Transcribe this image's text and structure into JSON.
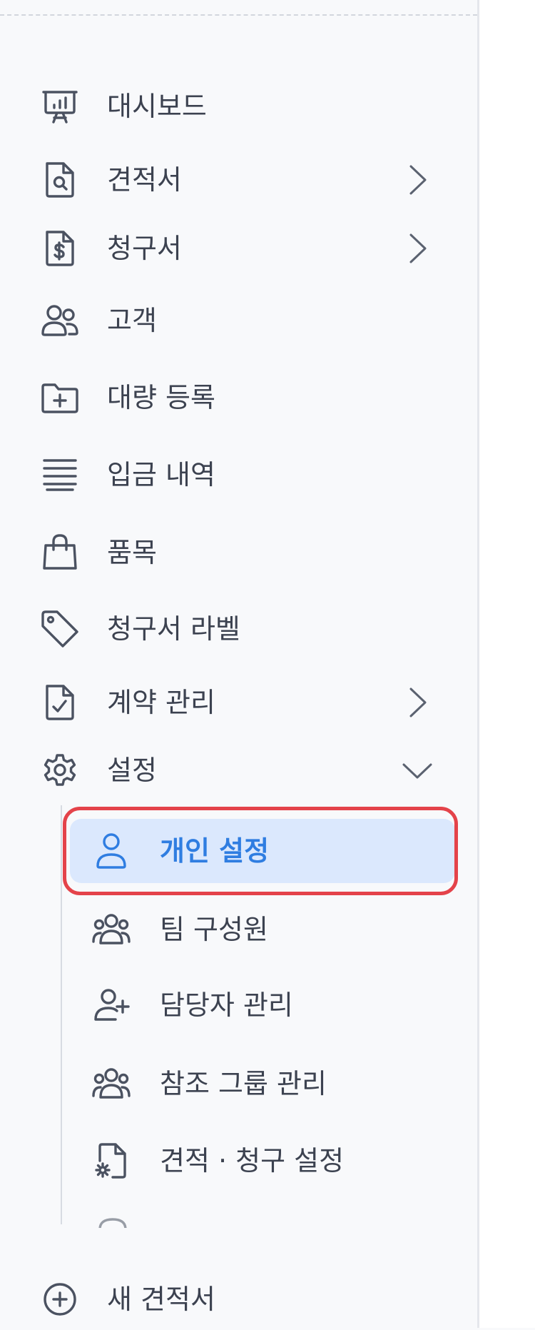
{
  "nav": {
    "items": [
      {
        "label": "대시보드",
        "icon": "presentation-chart-icon"
      },
      {
        "label": "견적서",
        "icon": "file-search-icon",
        "has_submenu": true
      },
      {
        "label": "청구서",
        "icon": "file-dollar-icon",
        "has_submenu": true
      },
      {
        "label": "고객",
        "icon": "users-icon"
      },
      {
        "label": "대량 등록",
        "icon": "folder-plus-icon"
      },
      {
        "label": "입금 내역",
        "icon": "list-lines-icon"
      },
      {
        "label": "품목",
        "icon": "shopping-bag-icon"
      },
      {
        "label": "청구서 라벨",
        "icon": "tag-icon"
      },
      {
        "label": "계약 관리",
        "icon": "file-check-icon",
        "has_submenu": true
      },
      {
        "label": "설정",
        "icon": "gear-icon",
        "expanded": true
      }
    ]
  },
  "settings_submenu": {
    "items": [
      {
        "label": "개인 설정",
        "icon": "user-icon",
        "active": true
      },
      {
        "label": "팀 구성원",
        "icon": "team-icon"
      },
      {
        "label": "담당자 관리",
        "icon": "user-plus-icon"
      },
      {
        "label": "참조 그룹 관리",
        "icon": "team-icon"
      },
      {
        "label": "견적 · 청구 설정",
        "icon": "file-settings-icon"
      }
    ]
  },
  "new_quote": {
    "label": "새 견적서",
    "icon": "plus-circle-icon"
  },
  "colors": {
    "background": "#f8f9fb",
    "text": "#3c4250",
    "accent": "#2f7de1",
    "active_bg": "#dbe8fd",
    "highlight_ring": "#e4434a"
  }
}
